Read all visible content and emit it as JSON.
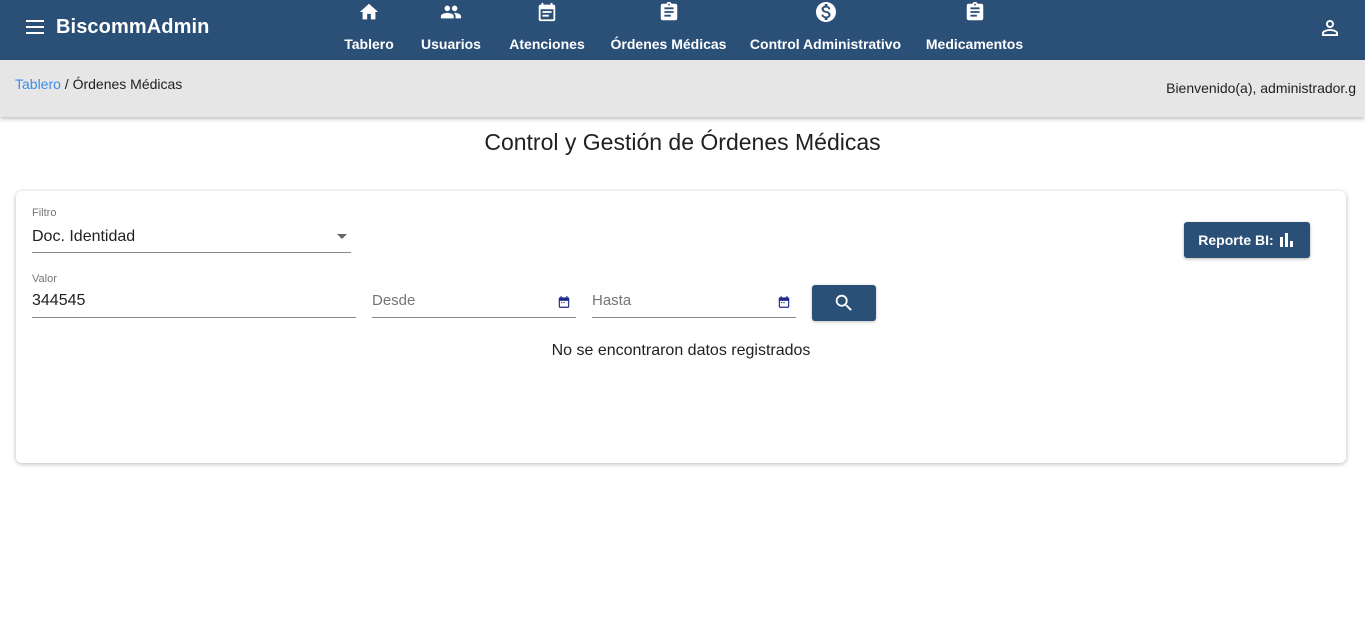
{
  "app": {
    "brand": "BiscommAdmin"
  },
  "nav": [
    {
      "label": "Tablero",
      "icon": "home-icon"
    },
    {
      "label": "Usuarios",
      "icon": "people-icon"
    },
    {
      "label": "Atenciones",
      "icon": "list-alt-icon"
    },
    {
      "label": "Órdenes Médicas",
      "icon": "assignment-icon"
    },
    {
      "label": "Control Administrativo",
      "icon": "dollar-circle-icon"
    },
    {
      "label": "Medicamentos",
      "icon": "assignment-icon"
    }
  ],
  "breadcrumb": {
    "home": "Tablero",
    "separator": " / ",
    "current": "Órdenes Médicas"
  },
  "welcome": "Bienvenido(a), administrador.g",
  "page": {
    "title": "Control y Gestión de Órdenes Médicas"
  },
  "filters": {
    "filter_label": "Filtro",
    "filter_value": "Doc. Identidad",
    "value_label": "Valor",
    "value_value": "344545",
    "from_placeholder": "Desde",
    "to_placeholder": "Hasta"
  },
  "report_button": "Reporte BI:",
  "empty_message": "No se encontraron datos registrados",
  "colors": {
    "primary": "#2b5078",
    "link": "#3f8ce8",
    "crumb_bg": "#e6e6e6",
    "calendar_icon": "#1f2a8c"
  }
}
